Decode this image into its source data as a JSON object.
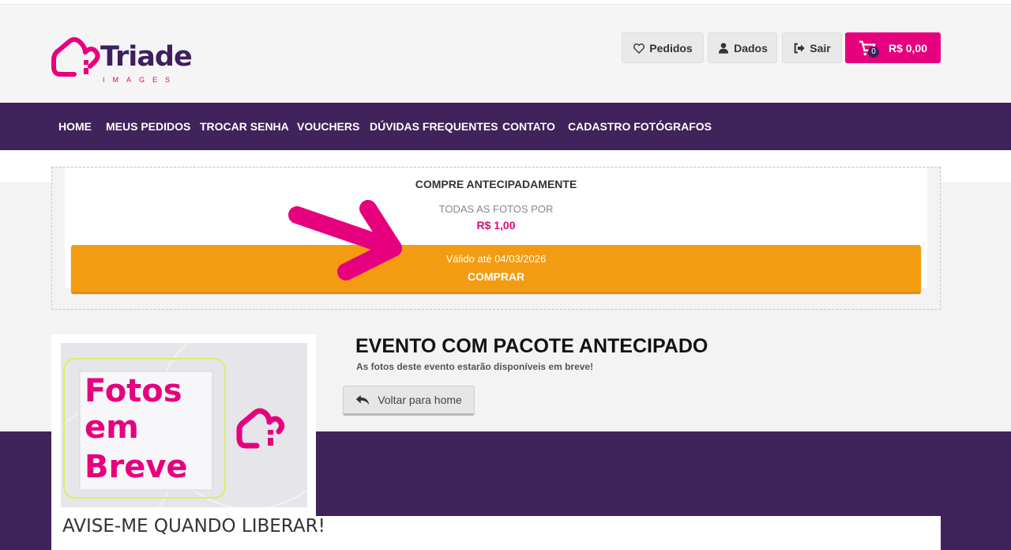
{
  "brand": {
    "name": "Triade",
    "subtitle": "IMAGES",
    "primary_color": "#e6007e",
    "secondary_color": "#3f235a",
    "accent_color": "#f39c12"
  },
  "header": {
    "pedidos_label": "Pedidos",
    "dados_label": "Dados",
    "sair_label": "Sair",
    "cart_count": "0",
    "cart_total": "R$ 0,00"
  },
  "nav": {
    "items": [
      "HOME",
      "MEUS PEDIDOS",
      "TROCAR SENHA",
      "VOUCHERS",
      "DÚVIDAS FREQUENTES",
      "CONTATO",
      "CADASTRO FOTÓGRAFOS"
    ]
  },
  "promo": {
    "title": "COMPRE ANTECIPADAMENTE",
    "subtitle": "TODAS AS FOTOS POR",
    "price": "R$ 1,00",
    "valid_until": "Válido até 04/03/2026",
    "buy_label": "COMPRAR"
  },
  "event": {
    "title": "EVENTO COM PACOTE ANTECIPADO",
    "subtitle": "As fotos deste evento estarão disponíveis em breve!",
    "back_label": "Voltar para home",
    "image_text": [
      "Fotos",
      "em",
      "Breve"
    ],
    "notify_label": "AVISE-ME QUANDO LIBERAR!"
  },
  "icons": {
    "pedidos": "heart-icon",
    "dados": "user-icon",
    "sair": "sign-out-icon",
    "cart": "cart-icon",
    "back": "reply-icon"
  }
}
